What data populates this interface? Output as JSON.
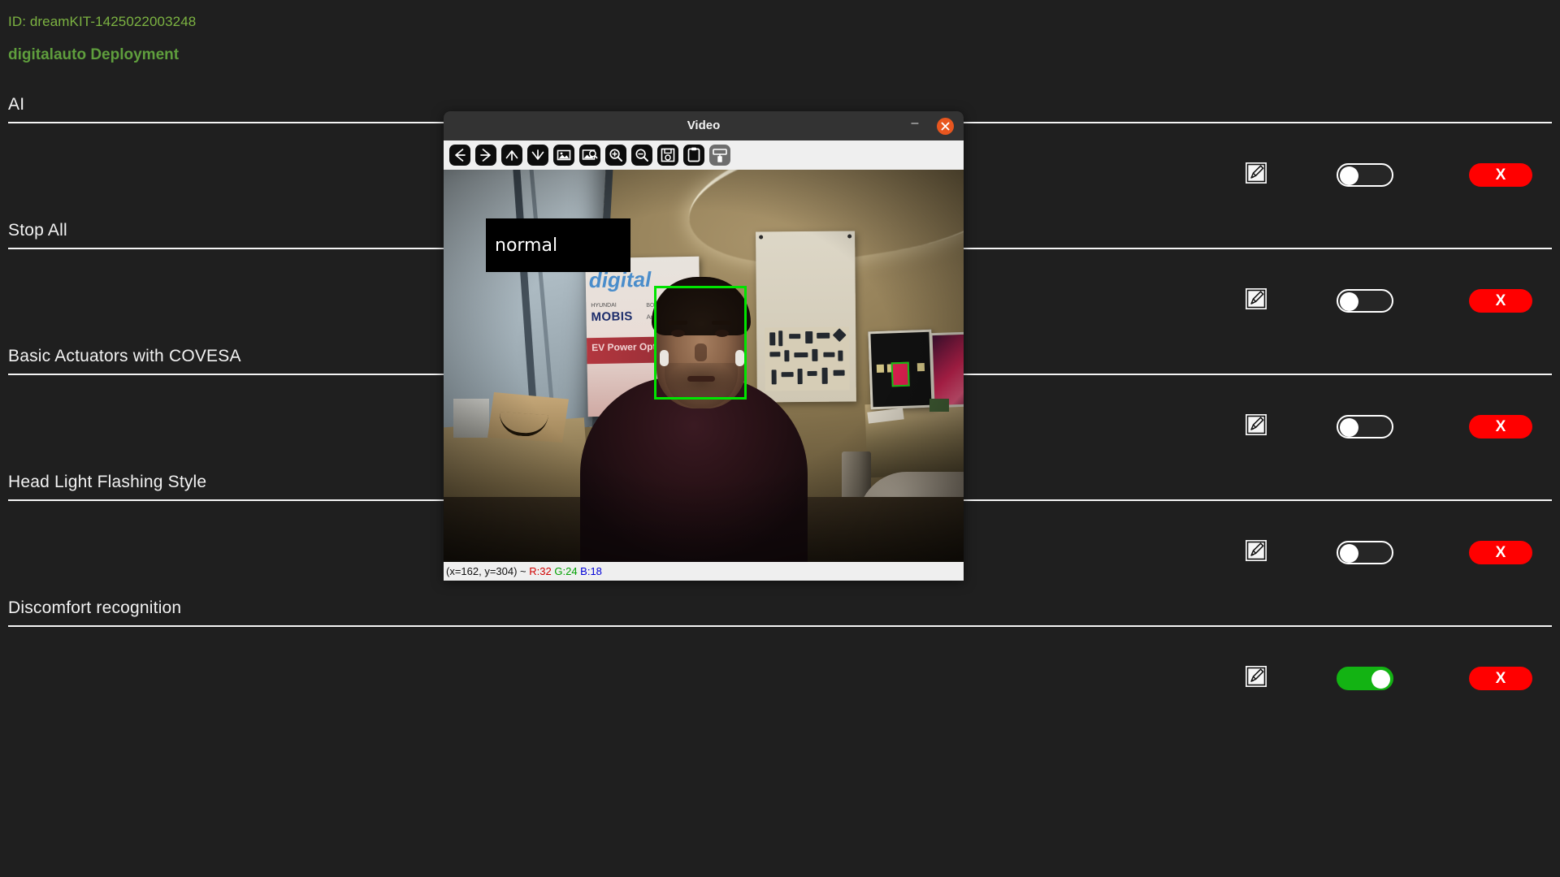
{
  "header": {
    "device_id": "ID: dreamKIT-1425022003248",
    "deployment_title": "digitalauto Deployment",
    "id_color": "#7cb342",
    "title_color": "#5f9e3d"
  },
  "rows": [
    {
      "label": "AI",
      "toggle_state": "off",
      "edit_label": "edit",
      "delete_label": "X"
    },
    {
      "label": "Stop All",
      "toggle_state": "off",
      "edit_label": "edit",
      "delete_label": "X"
    },
    {
      "label": "Basic Actuators with COVESA",
      "toggle_state": "off",
      "edit_label": "edit",
      "delete_label": "X"
    },
    {
      "label": "Head Light Flashing Style",
      "toggle_state": "off",
      "edit_label": "edit",
      "delete_label": "X"
    },
    {
      "label": "Discomfort recognition",
      "toggle_state": "on",
      "edit_label": "edit",
      "delete_label": "X"
    }
  ],
  "colors": {
    "background": "#1f1f1f",
    "divider": "#f4f4f4",
    "toggle_on": "#13b313",
    "toggle_off_border": "#ffffff",
    "delete_button": "#ff0000",
    "face_box": "#00e400",
    "titlebar": "#333333",
    "close_button": "#e8561f",
    "toolbar": "#efefef"
  },
  "video_window": {
    "title": "Video",
    "minimize_label": "–",
    "close_label": "✕",
    "toolbar_buttons": [
      {
        "name": "back-arrow-icon",
        "disabled": false
      },
      {
        "name": "forward-arrow-icon",
        "disabled": false
      },
      {
        "name": "up-arrow-icon",
        "disabled": false
      },
      {
        "name": "down-arrow-icon",
        "disabled": false
      },
      {
        "name": "image-icon",
        "disabled": false
      },
      {
        "name": "image-search-icon",
        "disabled": false
      },
      {
        "name": "zoom-in-icon",
        "disabled": false
      },
      {
        "name": "zoom-out-icon",
        "disabled": false
      },
      {
        "name": "save-floppy-icon",
        "disabled": false
      },
      {
        "name": "clipboard-icon",
        "disabled": false
      },
      {
        "name": "paint-roller-icon",
        "disabled": true
      }
    ],
    "overlay_label": "normal",
    "statusbar": {
      "coords": "(x=162, y=304) ~ ",
      "r": "R:32",
      "g": "G:24",
      "b": "B:18"
    },
    "scene": {
      "poster_digital": "digital",
      "poster_hyundai": "HYUNDAI",
      "poster_mobis": "MOBIS",
      "poster_bosch": "BOSCH",
      "poster_ansys": "Ansys",
      "poster_ev": "EV Power Optim"
    }
  }
}
